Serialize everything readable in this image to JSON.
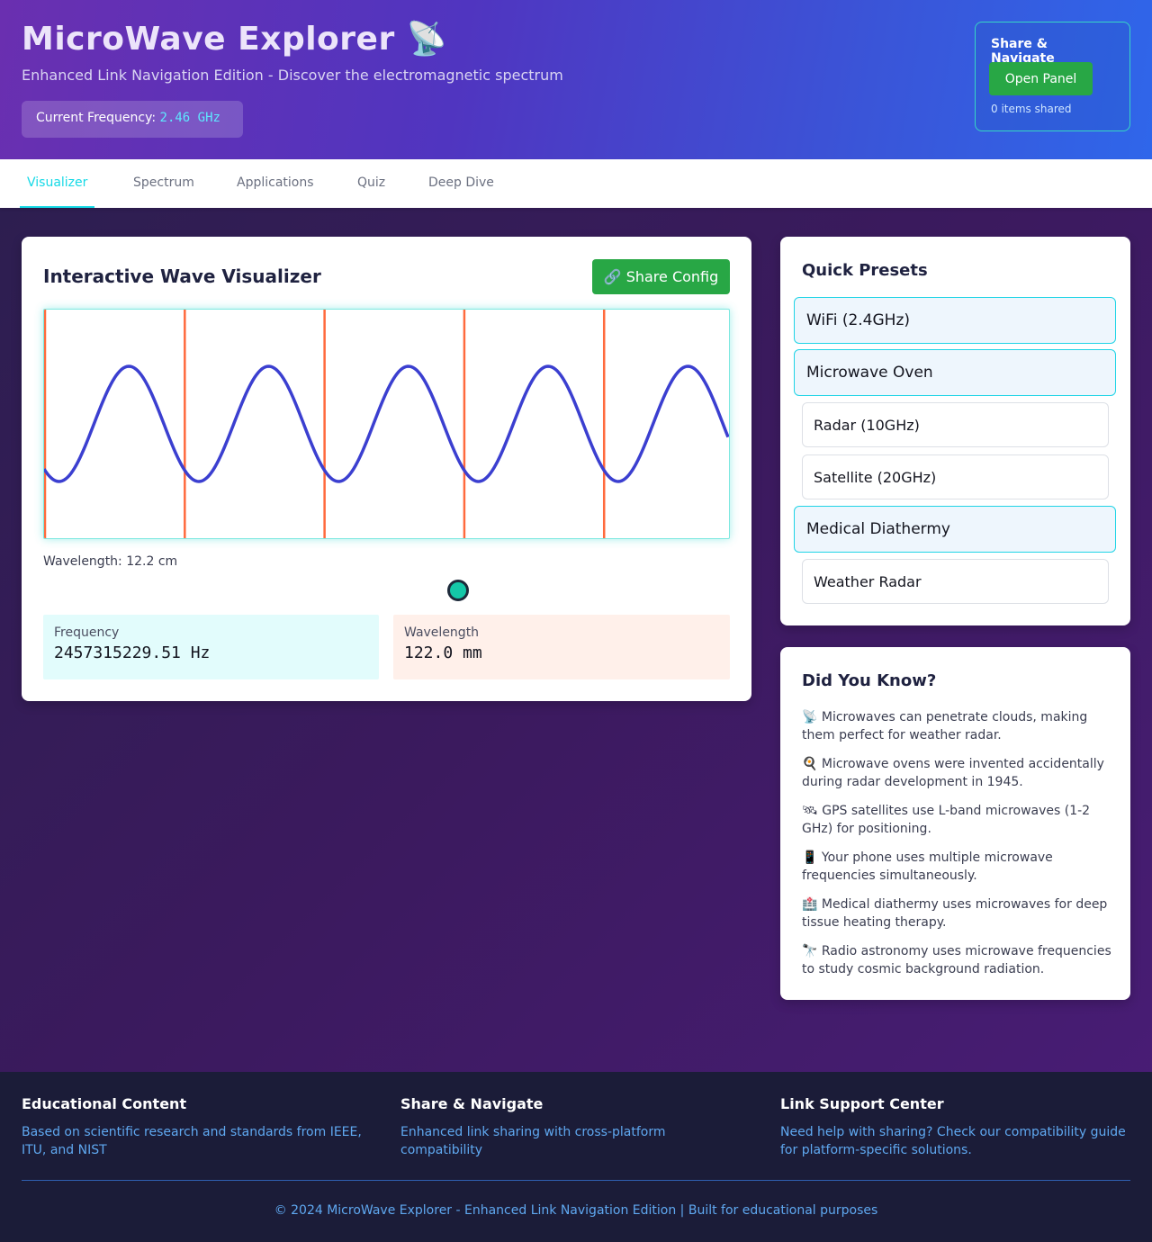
{
  "header": {
    "title": "MicroWave Explorer 📡",
    "subtitle": "Enhanced Link Navigation Edition - Discover the electromagnetic spectrum",
    "frequency_label": "Current Frequency:",
    "frequency_value": "2.46 GHz",
    "share_panel": {
      "title": "Share & Navigate",
      "button_label": "Open Panel",
      "count_text": "0 items shared"
    }
  },
  "nav": {
    "tabs": [
      {
        "label": "Visualizer",
        "active": true
      },
      {
        "label": "Spectrum",
        "active": false
      },
      {
        "label": "Applications",
        "active": false
      },
      {
        "label": "Quiz",
        "active": false
      },
      {
        "label": "Deep Dive",
        "active": false
      }
    ]
  },
  "visualizer": {
    "title": "Interactive Wave Visualizer",
    "share_button": "🔗 Share Config",
    "wavelength_text": "Wavelength: 12.2 cm",
    "frequency_label": "Frequency",
    "frequency_value": "2457315229.51 Hz",
    "wavelength_label": "Wavelength",
    "wavelength_value": "122.0 mm",
    "slider_fraction": 0.6,
    "wave": {
      "cycles_visible": 4.9,
      "marker_count": 5
    },
    "colors": {
      "wave": "#3b3fd0",
      "marker": "#ff6a3d",
      "accent": "#15d9e6"
    }
  },
  "presets": {
    "title": "Quick Presets",
    "items": [
      {
        "label": "WiFi (2.4GHz)",
        "highlighted": true
      },
      {
        "label": "Microwave Oven",
        "highlighted": true
      },
      {
        "label": "Radar (10GHz)",
        "highlighted": false
      },
      {
        "label": "Satellite (20GHz)",
        "highlighted": false
      },
      {
        "label": "Medical Diathermy",
        "highlighted": true
      },
      {
        "label": "Weather Radar",
        "highlighted": false
      }
    ]
  },
  "facts": {
    "title": "Did You Know?",
    "items": [
      "📡 Microwaves can penetrate clouds, making them perfect for weather radar.",
      "🍳 Microwave ovens were invented accidentally during radar development in 1945.",
      "🛰 GPS satellites use L-band microwaves (1-2 GHz) for positioning.",
      "📱 Your phone uses multiple microwave frequencies simultaneously.",
      "🏥 Medical diathermy uses microwaves for deep tissue heating therapy.",
      "🔭 Radio astronomy uses microwave frequencies to study cosmic background radiation."
    ]
  },
  "footer": {
    "columns": [
      {
        "title": "Educational Content",
        "text": "Based on scientific research and standards from IEEE, ITU, and NIST"
      },
      {
        "title": "Share & Navigate",
        "text": "Enhanced link sharing with cross-platform compatibility"
      },
      {
        "title": "Link Support Center",
        "text": "Need help with sharing? Check our compatibility guide for platform-specific solutions."
      }
    ],
    "copyright": "© 2024 MicroWave Explorer - Enhanced Link Navigation Edition | Built for educational purposes"
  }
}
